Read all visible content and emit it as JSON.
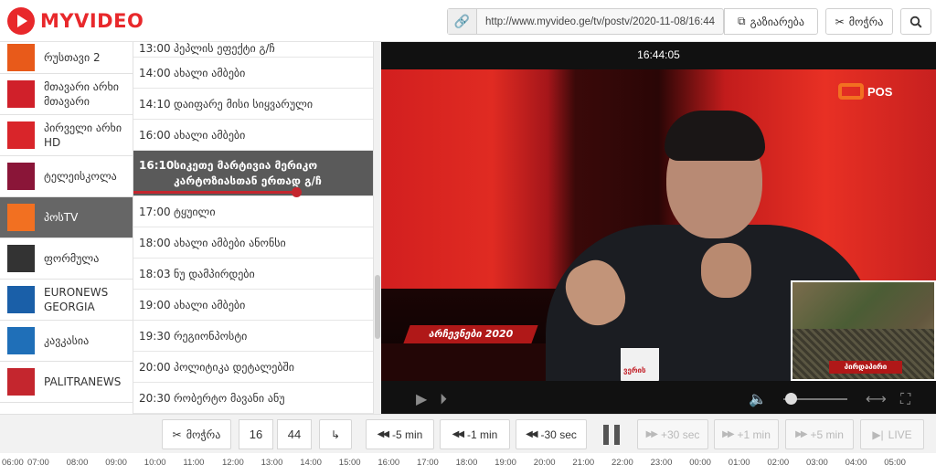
{
  "header": {
    "logo_text": "MYVIDEO",
    "url": "http://www.myvideo.ge/tv/postv/2020-11-08/16:44",
    "share_label": "გაზიარება",
    "cut_label": "მოჭრა",
    "link_icon": "link-icon",
    "search_icon": "search-icon"
  },
  "channels": [
    {
      "name": "რუსთავი 2",
      "logo_color": "#e85a1a"
    },
    {
      "name": "მთავარი არხი მთავარი",
      "logo_color": "#d0202a"
    },
    {
      "name": "პირველი არხი HD",
      "logo_color": "#d9252a"
    },
    {
      "name": "ტელეისკოლა",
      "logo_color": "#8a1538"
    },
    {
      "name": "პოსTV",
      "logo_color": "#f27021",
      "active": true
    },
    {
      "name": "ფორმულა",
      "logo_color": "#333333"
    },
    {
      "name": "EURONEWS GEORGIA",
      "logo_color": "#1a5fa8"
    },
    {
      "name": "კავკასია",
      "logo_color": "#1f6fb8"
    },
    {
      "name": "PALITRANEWS",
      "logo_color": "#c4262e"
    }
  ],
  "programs": [
    {
      "time": "13:00",
      "title": "პეპლის ეფექტი გ/ჩ"
    },
    {
      "time": "14:00",
      "title": "ახალი ამბები"
    },
    {
      "time": "14:10",
      "title": "დაიფარე მისი სიყვარული"
    },
    {
      "time": "16:00",
      "title": "ახალი ამბები"
    },
    {
      "time": "16:10",
      "title": "სიკეთე მარტივია მერიკო კარტოზიასთან ერთად გ/ჩ",
      "active": true,
      "progress": 0.68
    },
    {
      "time": "17:00",
      "title": "ტყუილი"
    },
    {
      "time": "18:00",
      "title": "ახალი ამბები ანონსი"
    },
    {
      "time": "18:03",
      "title": "ნუ დამპირდები"
    },
    {
      "time": "19:00",
      "title": "ახალი ამბები"
    },
    {
      "time": "19:30",
      "title": "რეგიონპოსტი"
    },
    {
      "time": "20:00",
      "title": "პოლიტიკა დეტალებში"
    },
    {
      "time": "20:30",
      "title": "რობერტო მავანი ანუ"
    }
  ],
  "player": {
    "clock": "16:44:05",
    "channel_badge": "POS",
    "lower_third": "არჩევნები 2020",
    "pip_label": "პირდაპირი",
    "mug_text": "ვერის",
    "volume": 0.1
  },
  "toolbar": {
    "cut_label": "მოჭრა",
    "hour": "16",
    "minute": "44",
    "colon": ":",
    "jump_icon": "arrow-return-icon",
    "minus5": "-5 min",
    "minus1": "-1 min",
    "minus30": "-30 sec",
    "plus30": "+30 sec",
    "plus1": "+1 min",
    "plus5": "+5 min",
    "live": "LIVE"
  },
  "timeline": [
    "06:00",
    "07:00",
    "08:00",
    "09:00",
    "10:00",
    "11:00",
    "12:00",
    "13:00",
    "14:00",
    "15:00",
    "16:00",
    "17:00",
    "18:00",
    "19:00",
    "20:00",
    "21:00",
    "22:00",
    "23:00",
    "00:00",
    "01:00",
    "02:00",
    "03:00",
    "04:00",
    "05:00"
  ]
}
